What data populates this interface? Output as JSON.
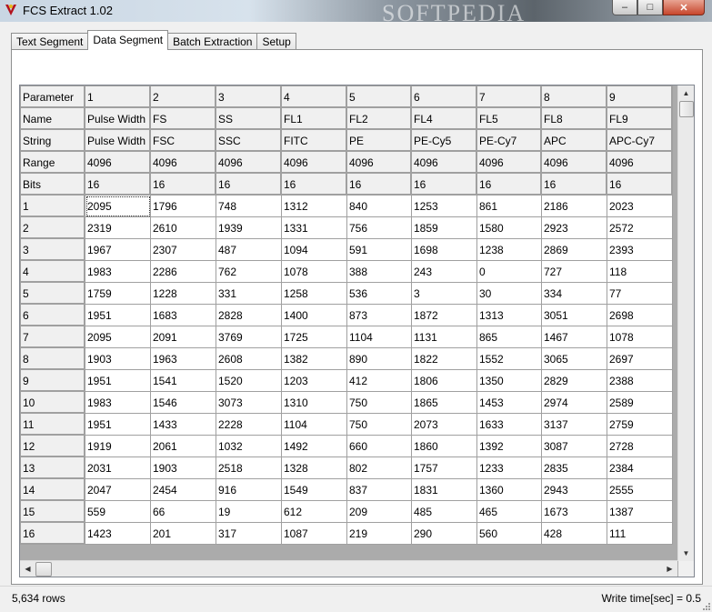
{
  "window": {
    "title": "FCS Extract 1.02",
    "watermark": "SOFTPEDIA"
  },
  "caption_buttons": {
    "minimize": "‒",
    "maximize": "□",
    "close": "✕"
  },
  "tabs": [
    {
      "label": "Text Segment",
      "active": false
    },
    {
      "label": "Data Segment",
      "active": true
    },
    {
      "label": "Batch Extraction",
      "active": false
    },
    {
      "label": "Setup",
      "active": false
    }
  ],
  "grid": {
    "header_rows": [
      [
        "Parameter",
        "1",
        "2",
        "3",
        "4",
        "5",
        "6",
        "7",
        "8",
        "9"
      ],
      [
        "Name",
        "Pulse Width",
        "FS",
        "SS",
        "FL1",
        "FL2",
        "FL4",
        "FL5",
        "FL8",
        "FL9"
      ],
      [
        "String",
        "Pulse Width",
        "FSC",
        "SSC",
        "FITC",
        "PE",
        "PE-Cy5",
        "PE-Cy7",
        "APC",
        "APC-Cy7"
      ],
      [
        "Range",
        "4096",
        "4096",
        "4096",
        "4096",
        "4096",
        "4096",
        "4096",
        "4096",
        "4096"
      ],
      [
        "Bits",
        "16",
        "16",
        "16",
        "16",
        "16",
        "16",
        "16",
        "16",
        "16"
      ]
    ],
    "data_rows": [
      [
        "1",
        "2095",
        "1796",
        "748",
        "1312",
        "840",
        "1253",
        "861",
        "2186",
        "2023"
      ],
      [
        "2",
        "2319",
        "2610",
        "1939",
        "1331",
        "756",
        "1859",
        "1580",
        "2923",
        "2572"
      ],
      [
        "3",
        "1967",
        "2307",
        "487",
        "1094",
        "591",
        "1698",
        "1238",
        "2869",
        "2393"
      ],
      [
        "4",
        "1983",
        "2286",
        "762",
        "1078",
        "388",
        "243",
        "0",
        "727",
        "118"
      ],
      [
        "5",
        "1759",
        "1228",
        "331",
        "1258",
        "536",
        "3",
        "30",
        "334",
        "77"
      ],
      [
        "6",
        "1951",
        "1683",
        "2828",
        "1400",
        "873",
        "1872",
        "1313",
        "3051",
        "2698"
      ],
      [
        "7",
        "2095",
        "2091",
        "3769",
        "1725",
        "1104",
        "1131",
        "865",
        "1467",
        "1078"
      ],
      [
        "8",
        "1903",
        "1963",
        "2608",
        "1382",
        "890",
        "1822",
        "1552",
        "3065",
        "2697"
      ],
      [
        "9",
        "1951",
        "1541",
        "1520",
        "1203",
        "412",
        "1806",
        "1350",
        "2829",
        "2388"
      ],
      [
        "10",
        "1983",
        "1546",
        "3073",
        "1310",
        "750",
        "1865",
        "1453",
        "2974",
        "2589"
      ],
      [
        "11",
        "1951",
        "1433",
        "2228",
        "1104",
        "750",
        "2073",
        "1633",
        "3137",
        "2759"
      ],
      [
        "12",
        "1919",
        "2061",
        "1032",
        "1492",
        "660",
        "1860",
        "1392",
        "3087",
        "2728"
      ],
      [
        "13",
        "2031",
        "1903",
        "2518",
        "1328",
        "802",
        "1757",
        "1233",
        "2835",
        "2384"
      ],
      [
        "14",
        "2047",
        "2454",
        "916",
        "1549",
        "837",
        "1831",
        "1360",
        "2943",
        "2555"
      ],
      [
        "15",
        "559",
        "66",
        "19",
        "612",
        "209",
        "485",
        "465",
        "1673",
        "1387"
      ],
      [
        "16",
        "1423",
        "201",
        "317",
        "1087",
        "219",
        "290",
        "560",
        "428",
        "111"
      ]
    ]
  },
  "status": {
    "rows": "5,634 rows",
    "write_time": "Write time[sec] = 0.5"
  },
  "colors": {
    "fixed_cell": "#f0f0f0",
    "grid_line": "#a0a0a0",
    "close_button": "#c7462c"
  }
}
